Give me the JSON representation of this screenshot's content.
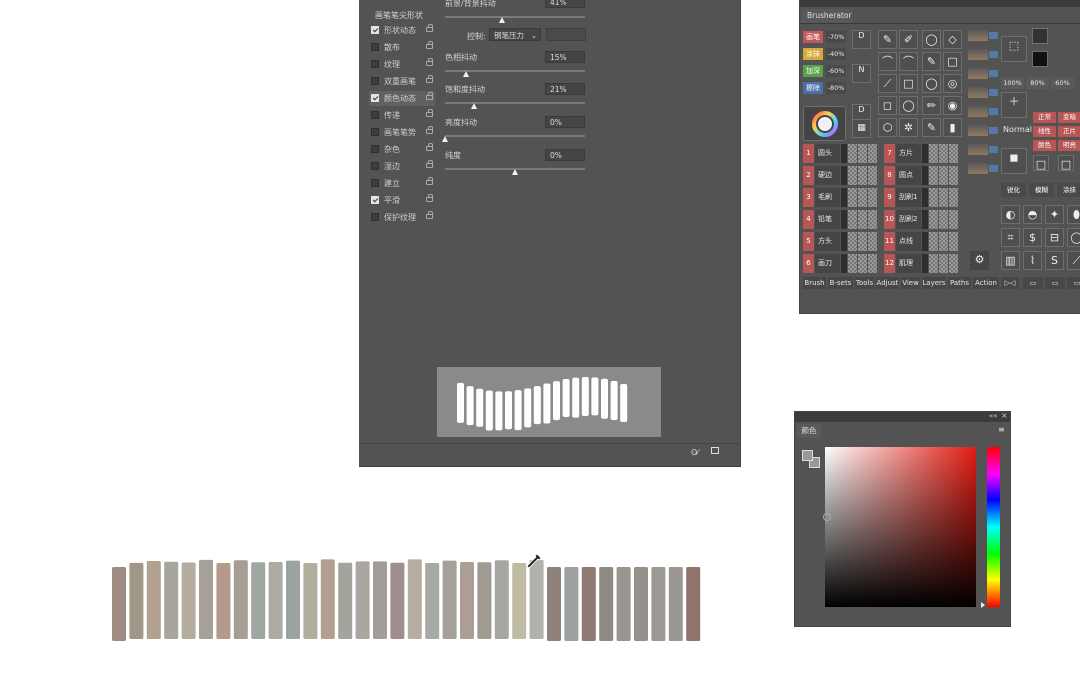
{
  "brush_panel": {
    "sidebar_title": "画笔笔尖形状",
    "items": [
      {
        "label": "形状动态",
        "checked": true
      },
      {
        "label": "散布",
        "checked": false
      },
      {
        "label": "纹理",
        "checked": false
      },
      {
        "label": "双重画笔",
        "checked": false
      },
      {
        "label": "颜色动态",
        "checked": true,
        "active": true
      },
      {
        "label": "传递",
        "checked": false
      },
      {
        "label": "画笔笔势",
        "checked": false
      },
      {
        "label": "杂色",
        "checked": false
      },
      {
        "label": "湿边",
        "checked": false
      },
      {
        "label": "建立",
        "checked": false
      },
      {
        "label": "平滑",
        "checked": true
      },
      {
        "label": "保护纹理",
        "checked": false
      }
    ],
    "top_param": {
      "label": "前景/背景抖动",
      "value": "41%",
      "fraction": 0.41
    },
    "control": {
      "label": "控制:",
      "selected": "钢笔压力"
    },
    "params": [
      {
        "label": "色相抖动",
        "value": "15%",
        "fraction": 0.15
      },
      {
        "label": "饱和度抖动",
        "value": "21%",
        "fraction": 0.21
      },
      {
        "label": "亮度抖动",
        "value": "0%",
        "fraction": 0.0
      },
      {
        "label": "纯度",
        "value": "0%",
        "fraction": 0.5
      }
    ]
  },
  "brusherator": {
    "tab_label": "Brusherator",
    "chips": [
      {
        "label": "画笔",
        "pct": "-70%",
        "color": "#c05a5a"
      },
      {
        "label": "涂抹",
        "pct": "-40%",
        "color": "#d6a93a"
      },
      {
        "label": "加深",
        "pct": "-60%",
        "color": "#5aa24a"
      },
      {
        "label": "擦除",
        "pct": "-80%",
        "color": "#4d6fa8"
      }
    ],
    "presets": [
      {
        "num": "1",
        "name": "圆头"
      },
      {
        "num": "2",
        "name": "硬边"
      },
      {
        "num": "3",
        "name": "毛刷"
      },
      {
        "num": "4",
        "name": "铅笔"
      },
      {
        "num": "5",
        "name": "方头"
      },
      {
        "num": "6",
        "name": "画刀"
      },
      {
        "num": "7",
        "name": "方片"
      },
      {
        "num": "8",
        "name": "圆点"
      },
      {
        "num": "9",
        "name": "刮刷1"
      },
      {
        "num": "10",
        "name": "刮刷2"
      },
      {
        "num": "11",
        "name": "点线"
      },
      {
        "num": "12",
        "name": "肌理"
      }
    ],
    "percents": [
      "100%",
      "80%",
      "60%"
    ],
    "blend_mode": "Normal",
    "side_buttons": [
      "正常",
      "变暗",
      "线性",
      "正片",
      "颜色",
      "明亮"
    ],
    "bottom_buttons": [
      "锐化",
      "模糊",
      "涂抹"
    ],
    "bottom_tabs": [
      "Brush",
      "B-sets",
      "Tools",
      "Adjust",
      "View",
      "Layers",
      "Paths",
      "Action"
    ],
    "icons": {
      "gear": "gear-icon",
      "color_wheel": "color-wheel-icon",
      "transparency": "transparency-icon"
    }
  },
  "color_panel": {
    "tab_label": "颜色",
    "fg_color": "#9a9a9a",
    "bg_color": "#9a9a9a",
    "hue_color": "#e21c12"
  },
  "strokes": {
    "colors": [
      "#a08a84",
      "#9f9889",
      "#b3a190",
      "#a6a79a",
      "#b4ac9f",
      "#a6a096",
      "#b39a8d",
      "#a69d94",
      "#9fa7a0",
      "#adaaa2",
      "#9aa3a2",
      "#b3ad9d",
      "#b19f91",
      "#a3a59d",
      "#aba6a0",
      "#a49c99",
      "#a08d8d",
      "#b5ad9f",
      "#a6a9a6",
      "#a5a09a",
      "#ad9e95",
      "#a19a92",
      "#a8a79f",
      "#c0bba4",
      "#b1b1ad",
      "#8e817c",
      "#9da0a1",
      "#8e7a73",
      "#8e8a84",
      "#9b9590",
      "#97918c",
      "#9d9a96",
      "#9a9794",
      "#8f7569"
    ]
  }
}
